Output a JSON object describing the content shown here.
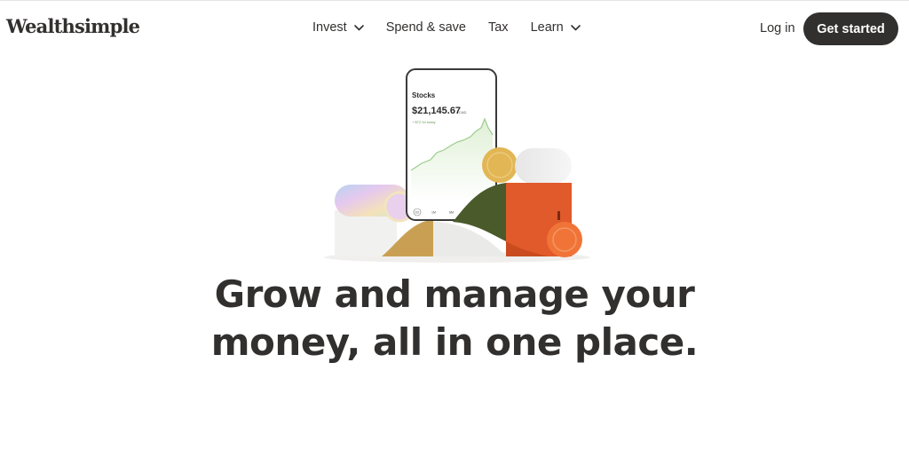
{
  "brand": {
    "logo_text": "Wealthsimple"
  },
  "nav": {
    "items": [
      {
        "label": "Invest",
        "has_dropdown": true,
        "icon": "chevron-down-icon"
      },
      {
        "label": "Spend & save",
        "has_dropdown": false
      },
      {
        "label": "Tax",
        "has_dropdown": false
      },
      {
        "label": "Learn",
        "has_dropdown": true,
        "icon": "chevron-down-icon"
      }
    ]
  },
  "header": {
    "login_label": "Log in",
    "cta_label": "Get started"
  },
  "phone": {
    "title": "Stocks",
    "balance": "$21,145.67",
    "currency": "CAD",
    "change": "+ $72.34 today",
    "ranges": [
      "1D",
      "1M",
      "6M"
    ]
  },
  "hero": {
    "headline_line1": "Grow and manage your",
    "headline_line2": "money, all in one place."
  },
  "colors": {
    "text": "#32302f",
    "button_bg": "#32302f",
    "button_text": "#ffffff",
    "chart_line": "#9ccc8c",
    "orange": "#e05a2b",
    "olive": "#4a5a2a",
    "gold": "#e2b654"
  }
}
